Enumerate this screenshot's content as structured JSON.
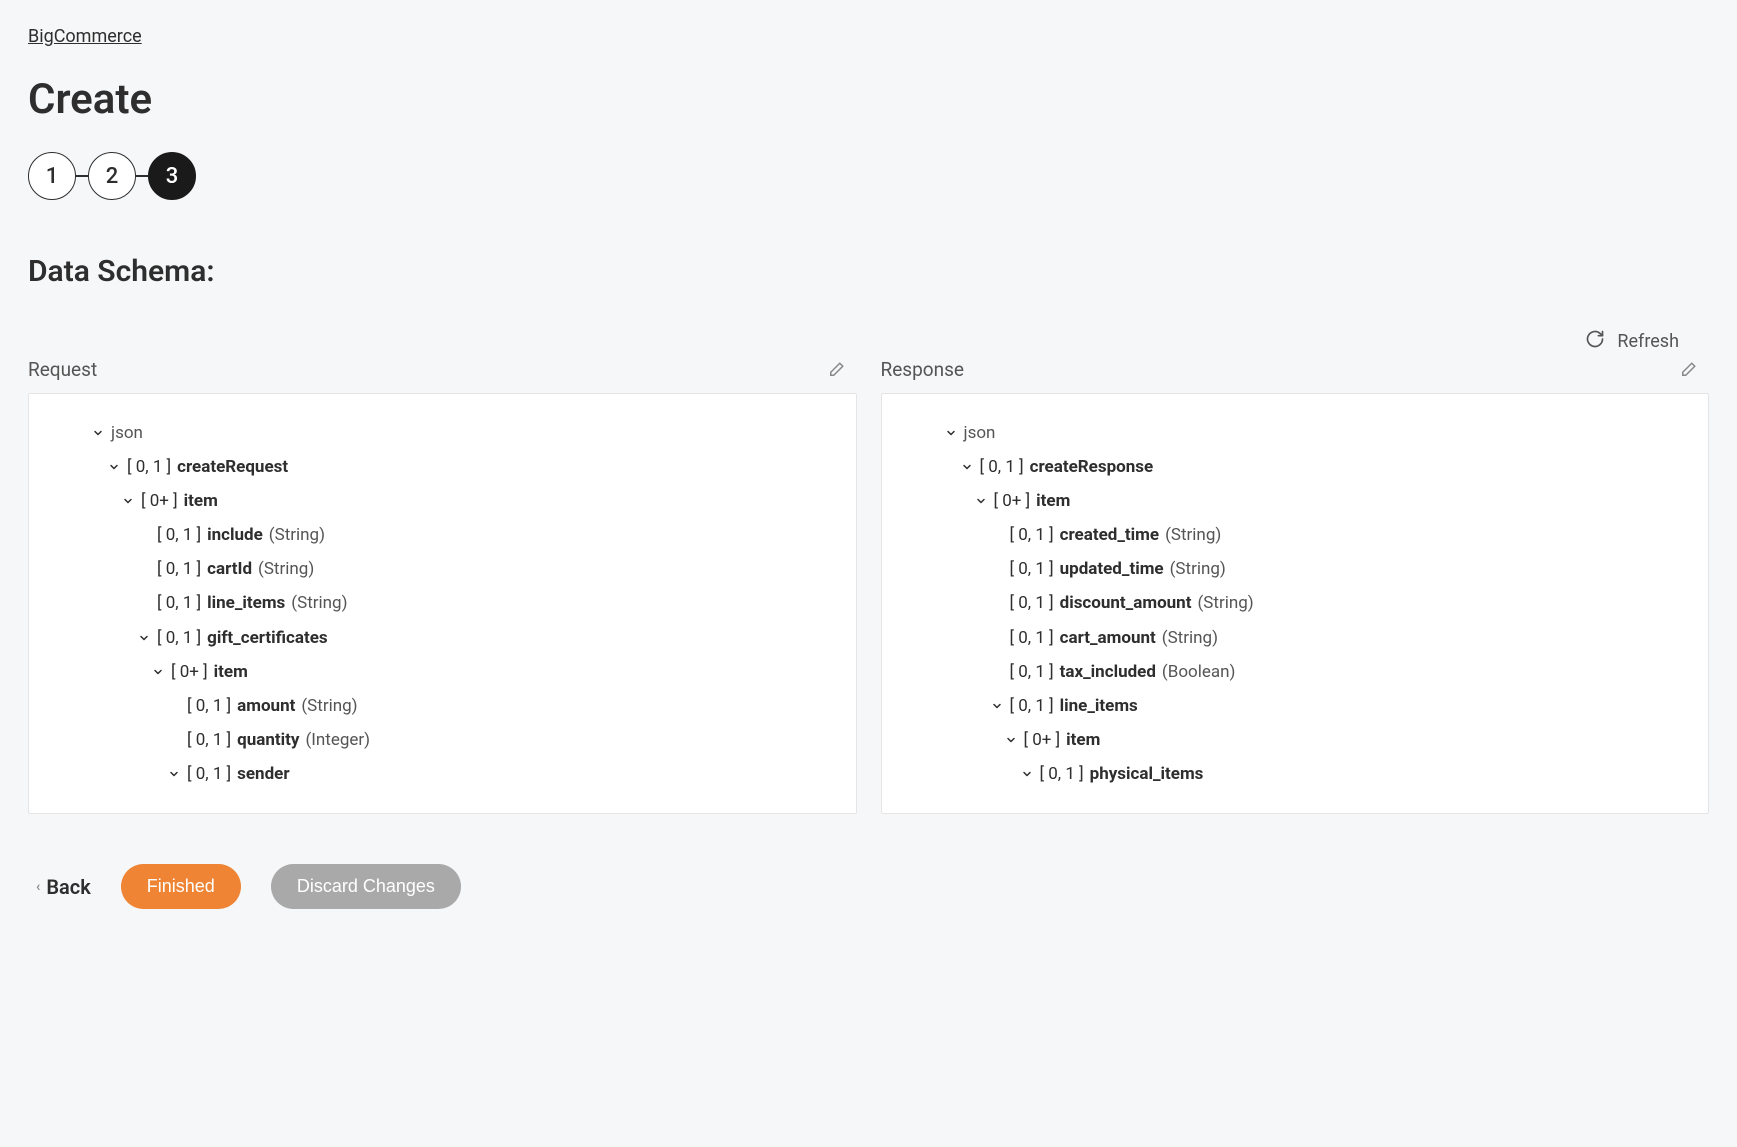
{
  "breadcrumb": "BigCommerce",
  "page_title": "Create",
  "stepper": {
    "steps": [
      "1",
      "2",
      "3"
    ],
    "active_index": 2
  },
  "section_title": "Data Schema:",
  "refresh_label": "Refresh",
  "request_label": "Request",
  "response_label": "Response",
  "footer": {
    "back": "Back",
    "finished": "Finished",
    "discard": "Discard Changes"
  },
  "request_tree": [
    {
      "depth": 0,
      "expandable": true,
      "label": "json",
      "root": true
    },
    {
      "depth": 1,
      "expandable": true,
      "cardinality": "[ 0, 1 ]",
      "name": "createRequest"
    },
    {
      "depth": 2,
      "expandable": true,
      "cardinality": "[ 0+ ]",
      "name": "item"
    },
    {
      "depth": 3,
      "expandable": false,
      "cardinality": "[ 0, 1 ]",
      "name": "include",
      "type": "(String)"
    },
    {
      "depth": 3,
      "expandable": false,
      "cardinality": "[ 0, 1 ]",
      "name": "cartId",
      "type": "(String)"
    },
    {
      "depth": 3,
      "expandable": false,
      "cardinality": "[ 0, 1 ]",
      "name": "line_items",
      "type": "(String)"
    },
    {
      "depth": 3,
      "expandable": true,
      "cardinality": "[ 0, 1 ]",
      "name": "gift_certificates"
    },
    {
      "depth": 4,
      "expandable": true,
      "cardinality": "[ 0+ ]",
      "name": "item"
    },
    {
      "depth": 5,
      "expandable": false,
      "cardinality": "[ 0, 1 ]",
      "name": "amount",
      "type": "(String)"
    },
    {
      "depth": 5,
      "expandable": false,
      "cardinality": "[ 0, 1 ]",
      "name": "quantity",
      "type": "(Integer)"
    },
    {
      "depth": 5,
      "expandable": true,
      "cardinality": "[ 0, 1 ]",
      "name": "sender"
    }
  ],
  "response_tree": [
    {
      "depth": 0,
      "expandable": true,
      "label": "json",
      "root": true
    },
    {
      "depth": 1,
      "expandable": true,
      "cardinality": "[ 0, 1 ]",
      "name": "createResponse"
    },
    {
      "depth": 2,
      "expandable": true,
      "cardinality": "[ 0+ ]",
      "name": "item"
    },
    {
      "depth": 3,
      "expandable": false,
      "cardinality": "[ 0, 1 ]",
      "name": "created_time",
      "type": "(String)"
    },
    {
      "depth": 3,
      "expandable": false,
      "cardinality": "[ 0, 1 ]",
      "name": "updated_time",
      "type": "(String)"
    },
    {
      "depth": 3,
      "expandable": false,
      "cardinality": "[ 0, 1 ]",
      "name": "discount_amount",
      "type": "(String)"
    },
    {
      "depth": 3,
      "expandable": false,
      "cardinality": "[ 0, 1 ]",
      "name": "cart_amount",
      "type": "(String)"
    },
    {
      "depth": 3,
      "expandable": false,
      "cardinality": "[ 0, 1 ]",
      "name": "tax_included",
      "type": "(Boolean)"
    },
    {
      "depth": 3,
      "expandable": true,
      "cardinality": "[ 0, 1 ]",
      "name": "line_items"
    },
    {
      "depth": 4,
      "expandable": true,
      "cardinality": "[ 0+ ]",
      "name": "item"
    },
    {
      "depth": 5,
      "expandable": true,
      "cardinality": "[ 0, 1 ]",
      "name": "physical_items"
    }
  ]
}
